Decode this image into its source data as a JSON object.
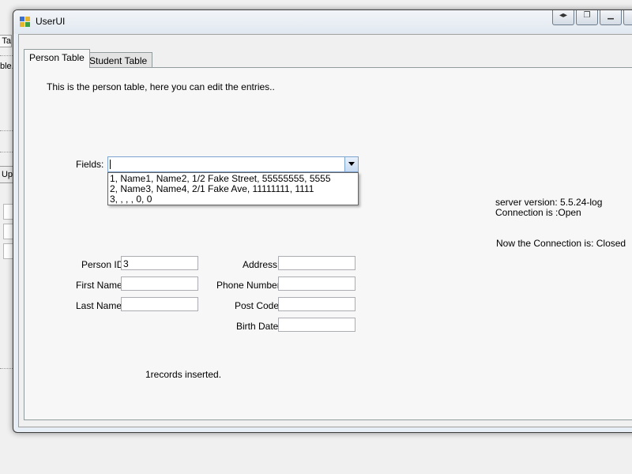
{
  "background_window": {
    "tab_label": "Ta",
    "text": "ble.",
    "button_label": "Up"
  },
  "window": {
    "title": "UserUI",
    "caption_buttons": [
      "swap-icon",
      "restore-icon",
      "minimize-icon",
      "maximize-icon"
    ]
  },
  "tabs": [
    {
      "label": "Person Table",
      "active": true
    },
    {
      "label": "Student Table",
      "active": false
    }
  ],
  "person_tab": {
    "description": "This is the person table, here you can edit the entries..",
    "fields_label": "Fields:",
    "combo_value": "",
    "dropdown_items": [
      "1, Name1, Name2, 1/2 Fake Street, 55555555, 5555",
      "2, Name3, Name4, 2/1 Fake Ave, 11111111, 1111",
      "3, , , , 0, 0"
    ],
    "form": {
      "person_id_label": "Person ID:",
      "person_id_value": "3",
      "first_name_label": "First Name:",
      "first_name_value": "",
      "last_name_label": "Last Name:",
      "last_name_value": "",
      "address_label": "Address:",
      "address_value": "",
      "phone_label": "Phone Number:",
      "phone_value": "",
      "postcode_label": "Post Code:",
      "postcode_value": "",
      "birthdate_label": "Birth Date:",
      "birthdate_value": ""
    },
    "status": {
      "server_version": "server version: 5.5.24-log",
      "connection_open": "Connection is :Open",
      "connection_closed": "Now the Connection is: Closed",
      "records_inserted": "1records inserted."
    }
  }
}
